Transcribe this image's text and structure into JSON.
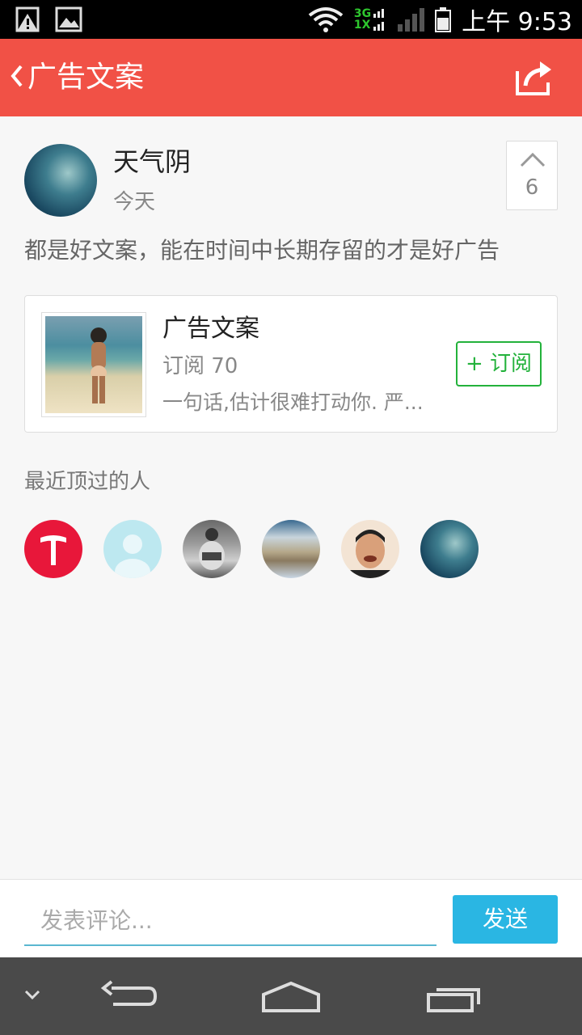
{
  "status_bar": {
    "network_top": "3G",
    "network_bottom": "1X",
    "time": "上午 9:53"
  },
  "app_bar": {
    "title": "广告文案",
    "back_icon": "chevron-left-icon",
    "share_icon": "share-icon"
  },
  "post": {
    "username": "天气阴",
    "time": "今天",
    "upvotes": "6",
    "text": "都是好文案，能在时间中长期存留的才是好广告"
  },
  "channel": {
    "title": "广告文案",
    "subscribers": "订阅 70",
    "description": "一句话,估计很难打动你. 严...",
    "subscribe_label": "+ 订阅"
  },
  "recent": {
    "label": "最近顶过的人",
    "count": 6
  },
  "comment": {
    "placeholder": "发表评论...",
    "send_label": "发送"
  },
  "colors": {
    "app_bar": "#f15146",
    "subscribe": "#23b23b",
    "send": "#2ab6e3",
    "input_underline": "#5ab7d0"
  }
}
